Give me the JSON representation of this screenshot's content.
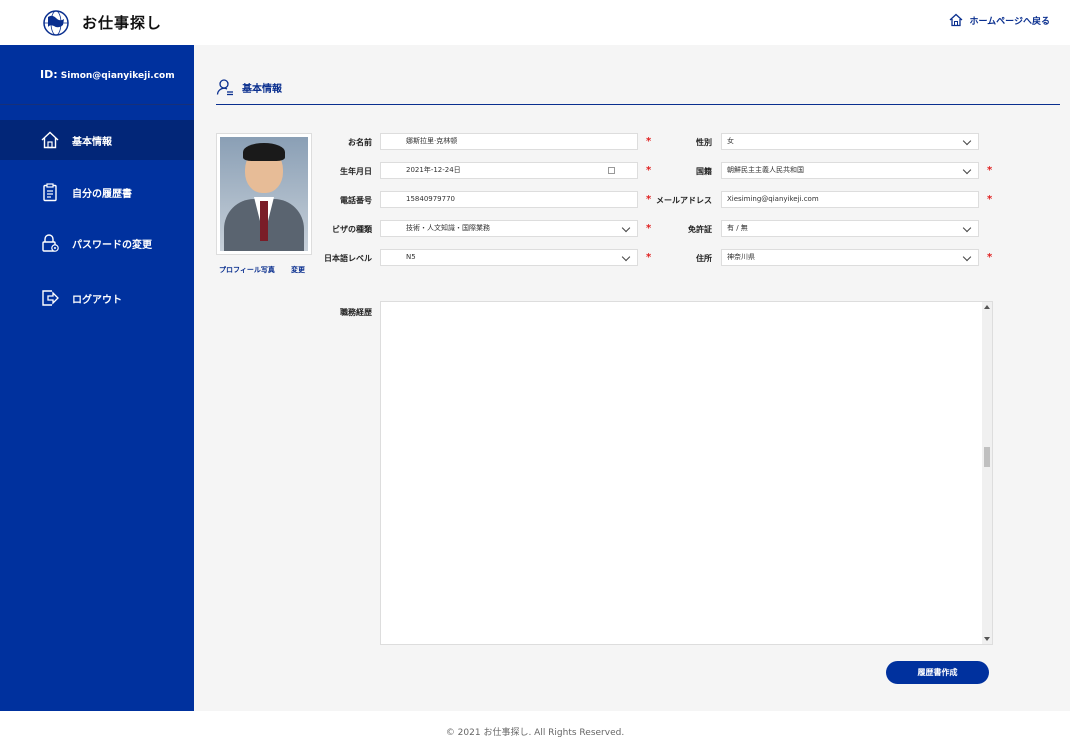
{
  "header": {
    "site_title": "お仕事探し",
    "home_link": "ホームページへ戻る"
  },
  "sidebar": {
    "id_label": "ID:",
    "user_email": "Simon@qianyikeji.com",
    "items": [
      {
        "label": "基本情報",
        "icon": "home-icon",
        "active": true
      },
      {
        "label": "自分の履歴書",
        "icon": "clipboard-icon",
        "active": false
      },
      {
        "label": "パスワードの変更",
        "icon": "lock-gear-icon",
        "active": false
      },
      {
        "label": "ログアウト",
        "icon": "logout-icon",
        "active": false
      }
    ]
  },
  "main": {
    "section_title": "基本情報",
    "photo": {
      "label": "プロフィール写真",
      "change_link": "変更"
    },
    "form": {
      "name": {
        "label": "お名前",
        "value": "娜斯拉里·克林顿"
      },
      "birthday": {
        "label": "生年月日",
        "value": "2021年-12-24日"
      },
      "phone": {
        "label": "電話番号",
        "value": "15840979770"
      },
      "visa": {
        "label": "ビザの種類",
        "value": "技術・人文知識・国際業務"
      },
      "japanese": {
        "label": "日本語レベル",
        "value": "N5"
      },
      "gender": {
        "label": "性別",
        "value": "女"
      },
      "nationality": {
        "label": "国籍",
        "value": "朝鮮民主主義人民共和国"
      },
      "email": {
        "label": "メールアドレス",
        "value": "Xiesiming@qianyikeji.com"
      },
      "license": {
        "label": "免許証",
        "value": "有 / 無"
      },
      "address": {
        "label": "住所",
        "value": "神奈川県"
      },
      "career": {
        "label": "職務経歴",
        "value": ""
      },
      "required_mark": "*"
    },
    "create_button": "履歴書作成"
  },
  "footer": {
    "copyright": "© 2021 お仕事探し. All Rights Reserved."
  },
  "colors": {
    "brand": "#00319e",
    "active_nav": "#022678",
    "required": "#e02020"
  }
}
